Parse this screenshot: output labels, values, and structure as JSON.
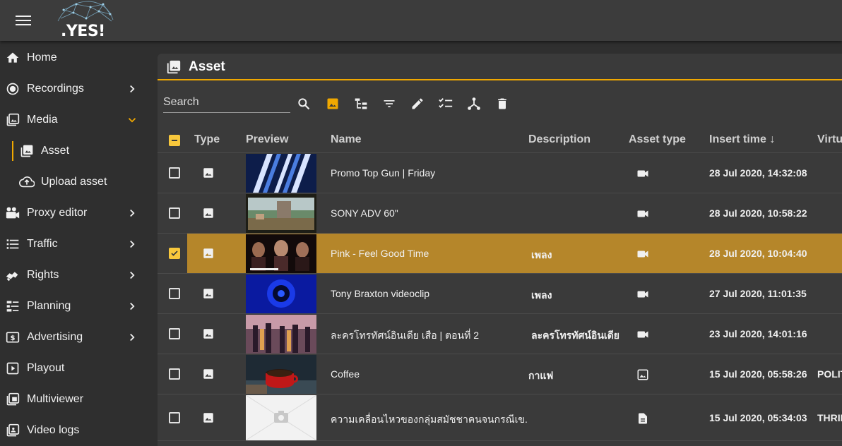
{
  "app": {
    "logo_text": ".YES!"
  },
  "sidebar": {
    "items": [
      {
        "label": "Home",
        "icon": "home-icon"
      },
      {
        "label": "Recordings",
        "icon": "record-icon"
      },
      {
        "label": "Media",
        "icon": "media-icon"
      },
      {
        "label": "Asset",
        "icon": "asset-icon"
      },
      {
        "label": "Upload asset",
        "icon": "cloud-upload-icon"
      },
      {
        "label": "Proxy editor",
        "icon": "camera-icon"
      },
      {
        "label": "Traffic",
        "icon": "list-icon"
      },
      {
        "label": "Rights",
        "icon": "handshake-icon"
      },
      {
        "label": "Planning",
        "icon": "planning-icon"
      },
      {
        "label": "Advertising",
        "icon": "dollar-icon"
      },
      {
        "label": "Playout",
        "icon": "play-icon"
      },
      {
        "label": "Multiviewer",
        "icon": "multiviewer-icon"
      },
      {
        "label": "Video logs",
        "icon": "video-logs-icon"
      }
    ]
  },
  "panel": {
    "title": "Asset",
    "search_placeholder": "Search"
  },
  "table": {
    "headers": {
      "type": "Type",
      "preview": "Preview",
      "name": "Name",
      "description": "Description",
      "asset_type": "Asset type",
      "insert_time": "Insert time ↓",
      "virtual": "Virtu"
    },
    "rows": [
      {
        "name": "Promo Top Gun | Friday",
        "description": "",
        "asset_type": "video",
        "insert_time": "28 Jul 2020, 14:32:08",
        "virtual": "",
        "selected": false
      },
      {
        "name": "SONY ADV 60\"",
        "description": "",
        "asset_type": "video",
        "insert_time": "28 Jul 2020, 10:58:22",
        "virtual": "",
        "selected": false
      },
      {
        "name": "Pink - Feel Good Time",
        "description": "เพลง",
        "asset_type": "video",
        "insert_time": "28 Jul 2020, 10:04:40",
        "virtual": "",
        "selected": true
      },
      {
        "name": "Tony Braxton videoclip",
        "description": "เพลง",
        "asset_type": "video",
        "insert_time": "27 Jul 2020, 11:01:35",
        "virtual": "",
        "selected": false
      },
      {
        "name": " ละครโทรทัศน์อินเดีย เสือ |  ตอนที่ 2",
        "description": "ละครโทรทัศน์อินเดีย",
        "asset_type": "video",
        "insert_time": "23 Jul 2020, 14:01:16",
        "virtual": "",
        "selected": false
      },
      {
        "name": "Coffee",
        "description": "กาแฟ",
        "asset_type": "image",
        "insert_time": "15 Jul 2020, 05:58:26",
        "virtual": "POLIT",
        "selected": false
      },
      {
        "name": "ความเคลื่อนไหวของกลุ่มสมัชชาคนจนกรณีเข.",
        "description": "",
        "asset_type": "document",
        "insert_time": "15 Jul 2020, 05:34:03",
        "virtual": "THRIL",
        "selected": false
      }
    ]
  },
  "colors": {
    "accent": "#f0a800",
    "selected_row": "#b5862a",
    "checkbox": "#f7c73c"
  }
}
